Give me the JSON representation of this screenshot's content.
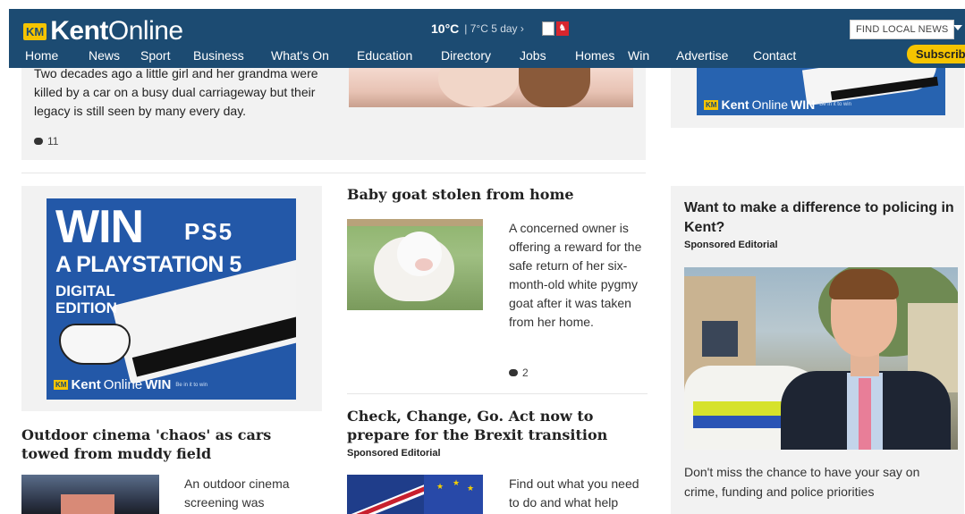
{
  "header": {
    "logo_badge": "KM",
    "logo_kent": "Kent",
    "logo_online": "Online",
    "weather_temp": "10°C",
    "weather_rest": "| 7°C 5 day ›",
    "find_local_news": "FIND LOCAL NEWS",
    "subscribe": "Subscribe"
  },
  "nav": [
    "Home",
    "News",
    "Sport",
    "Business",
    "What's On",
    "Education",
    "Directory",
    "Jobs",
    "Homes",
    "Win",
    "Advertise",
    "Contact"
  ],
  "top_story": {
    "text": "Two decades ago a little girl and her grandma were killed by a car on a busy dual carriageway but their legacy is still seen by many every day.",
    "comments": "11"
  },
  "ad_top_right": {
    "brand_badge": "KM",
    "brand_kent": "Kent",
    "brand_online": "Online",
    "brand_win": "WIN",
    "brand_tiny": "Be in it to win"
  },
  "ad_ps5": {
    "win": "WIN",
    "ps_logo": "PS5",
    "headline": "A PLAYSTATION 5",
    "sub1": "DIGITAL",
    "sub2": "EDITION",
    "brand_badge": "KM",
    "brand_kent": "Kent",
    "brand_online": "Online",
    "brand_win": "WIN",
    "brand_tiny": "Be in it to win"
  },
  "goat": {
    "title": "Baby goat stolen from home",
    "text": "A concerned owner is offering a reward for the safe return of her six-month-old white pygmy goat after it was taken from her home.",
    "comments": "2"
  },
  "check": {
    "title": "Check, Change, Go. Act now to prepare for the Brexit transition",
    "sponsor": "Sponsored Editorial",
    "text": "Find out what you need to do and what help"
  },
  "outdoor": {
    "title": "Outdoor cinema 'chaos' as cars towed from muddy field",
    "text": "An outdoor cinema screening was"
  },
  "police": {
    "title": "Want to make a difference to policing in Kent?",
    "sponsor": "Sponsored Editorial",
    "text": "Don't miss the chance to have your say on crime, funding and police priorities"
  }
}
